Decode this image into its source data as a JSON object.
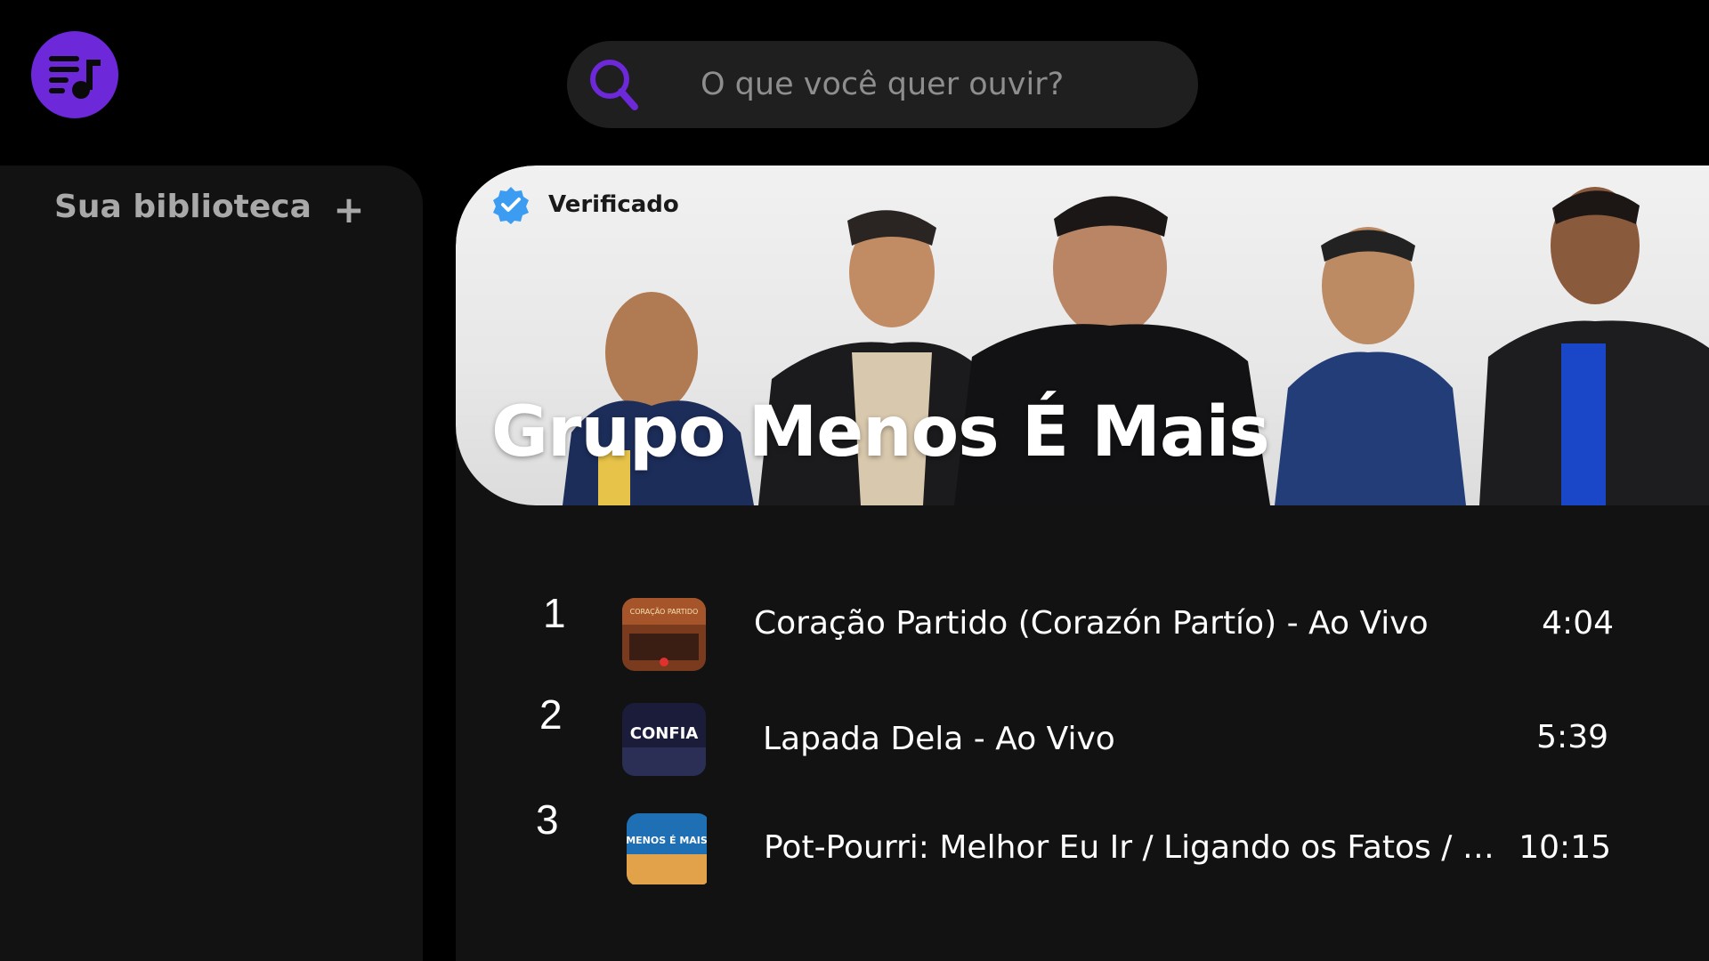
{
  "logo": {
    "icon": "music-playlist-icon",
    "color": "#6d28d9"
  },
  "search": {
    "placeholder": "O que você quer ouvir?",
    "icon": "search-icon",
    "icon_color": "#6d28d9"
  },
  "sidebar": {
    "title": "Sua biblioteca",
    "add_label": "+"
  },
  "artist": {
    "verified_label": "Verificado",
    "name": "Grupo Menos É Mais"
  },
  "tracks": [
    {
      "number": "1",
      "title": "Coração Partido (Corazón Partío) - Ao Vivo",
      "duration": "4:04",
      "cover_text": "CORAÇÃO PARTIDO"
    },
    {
      "number": "2",
      "title": "Lapada Dela - Ao Vivo",
      "duration": "5:39",
      "cover_text": "CONFIA"
    },
    {
      "number": "3",
      "title": "Pot-Pourri: Melhor Eu Ir / Ligando os Fatos / Sonho de Amor / Deixa Eu Te Querer - Ao Vivo",
      "duration": "10:15",
      "cover_text": "MENOS É MAIS"
    }
  ]
}
